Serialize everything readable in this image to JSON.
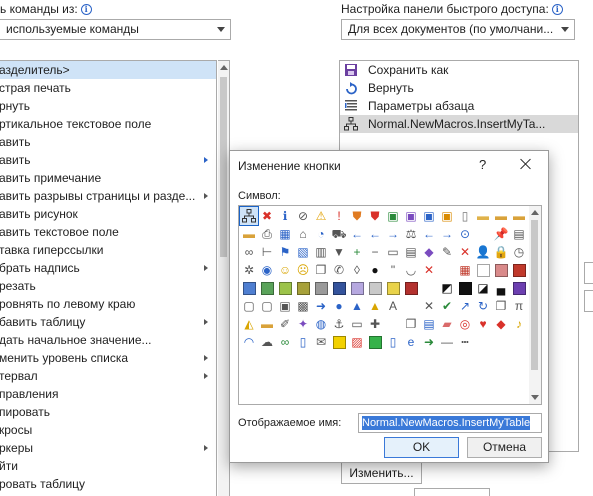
{
  "left_panel": {
    "label": "ь команды из:",
    "combo_value": "используемые команды",
    "items": [
      {
        "label": "азделитель>",
        "selected": true,
        "submenu": false
      },
      {
        "label": "страя печать",
        "submenu": false
      },
      {
        "label": "рнуть",
        "submenu": false
      },
      {
        "label": "ртикальное текстовое поле",
        "submenu": false
      },
      {
        "label": "авить",
        "submenu": false
      },
      {
        "label": "авить",
        "submenu": true
      },
      {
        "label": "авить примечание",
        "submenu": false
      },
      {
        "label": "авить разрывы страницы и разде...",
        "submenu": true
      },
      {
        "label": "авить рисунок",
        "submenu": false
      },
      {
        "label": "авить текстовое поле",
        "submenu": false
      },
      {
        "label": "тавка гиперссылки",
        "submenu": false
      },
      {
        "label": "брать надпись",
        "submenu": true
      },
      {
        "label": "резать",
        "submenu": false
      },
      {
        "label": "ровнять по левому краю",
        "submenu": false
      },
      {
        "label": "бавить таблицу",
        "submenu": true
      },
      {
        "label": "дать начальное значение...",
        "submenu": false
      },
      {
        "label": "менить уровень списка",
        "submenu": true
      },
      {
        "label": "тервал",
        "submenu": true
      },
      {
        "label": "правления",
        "submenu": false
      },
      {
        "label": "пировать",
        "submenu": false
      },
      {
        "label": "кросы",
        "submenu": false
      },
      {
        "label": "ркеры",
        "submenu": true
      },
      {
        "label": "йти",
        "submenu": false
      },
      {
        "label": "ровать таблицу",
        "submenu": false
      }
    ]
  },
  "right_panel": {
    "label": "Настройка панели быстрого доступа:",
    "combo_value": "Для всех документов (по умолчани...",
    "items": [
      {
        "label": "Сохранить как",
        "icon": "save-as-icon"
      },
      {
        "label": "Вернуть",
        "icon": "redo-icon"
      },
      {
        "label": "Параметры абзаца",
        "icon": "paragraph-settings-icon"
      },
      {
        "label": "Normal.NewMacros.InsertMyTa...",
        "icon": "macro-icon",
        "selected": true
      }
    ],
    "change_button": "Изменить..."
  },
  "dialog": {
    "title": "Изменение кнопки",
    "help": "?",
    "symbol_label": "Символ:",
    "display_name_label": "Отображаемое имя:",
    "display_name_value": "Normal.NewMacros.InsertMyTable",
    "ok_label": "OK",
    "cancel_label": "Отмена",
    "icons": [
      [
        "sitemap-icon",
        "error-icon",
        "info-icon",
        "stop-icon",
        "warning-icon",
        "exclamation-icon",
        "shield-warning-icon",
        "shield-icon",
        "image-check-icon",
        "image-icon",
        "image-back-icon",
        "image-forward-icon",
        "document-icon",
        "folder-icon",
        "folder-open-icon"
      ],
      [
        "folder-tree-icon",
        "folder-copy-icon",
        "printer-icon",
        "calendar-icon",
        "home-icon",
        "pie-chart-icon",
        "cart-icon",
        "arrow-left-icon",
        "arrow-left2-icon",
        "arrow-right-icon",
        "scales-icon",
        "arrow-left3-icon",
        "arrow-right2-icon",
        "back-circle-icon",
        "blank-icon"
      ],
      [
        "pin-icon",
        "paste-icon",
        "link-icon",
        "tree-icon",
        "flag-icon",
        "box-icon",
        "bar-chart-icon",
        "filter-icon",
        "plus-icon",
        "minus-icon",
        "ruler-icon",
        "clipboard-icon",
        "shapes-icon",
        "pencil-icon",
        "map-icon"
      ],
      [
        "user-icon",
        "lock-icon",
        "clock-icon",
        "settings-icon",
        "earth-icon",
        "smile-icon",
        "sad-icon",
        "copy-icon",
        "phone-icon",
        "tag-icon",
        "eight-ball-icon",
        "quote-icon",
        "eye-icon",
        "no-eye-icon",
        "blank-icon"
      ],
      [
        "grid-icon",
        "white-square",
        "rose-square",
        "red-square",
        "blue-square",
        "green-square",
        "lime-square",
        "olive-square",
        "gray-square",
        "navy-square",
        "lavender-square",
        "gray-square-2",
        "yellow-square",
        "red-square-2",
        "blank-icon"
      ],
      [
        "split-square",
        "black-square",
        "half-square",
        "bottom-square",
        "purple-square",
        "window-icon",
        "frame-icon",
        "panel-icon",
        "checker-icon",
        "arrow-circle-icon",
        "sphere-icon",
        "chart-up-icon",
        "pyramid-icon",
        "letter-a-icon",
        "blank-icon"
      ],
      [
        "cross-icon",
        "check-icon",
        "chart-line-icon",
        "refresh-icon",
        "copy-plus-icon",
        "pi-icon",
        "paint-bucket-icon",
        "folder-picture-icon",
        "brush-icon",
        "wand-icon",
        "globe-icon",
        "anchor-icon",
        "briefcase-icon",
        "puzzle-icon",
        "blank-icon"
      ],
      [
        "documents-icon",
        "database-icon",
        "eraser-icon",
        "dart-icon",
        "heart-icon",
        "bookmark-icon",
        "bell-icon",
        "rainbow-icon",
        "cloud-icon",
        "ribbon-icon",
        "door-icon",
        "mail-icon",
        "yellow-square-2",
        "stripes-icon",
        "green-square-2"
      ],
      [
        "document-blue-icon",
        "ie-icon",
        "arrow-green-icon",
        "line-icon",
        "dash-line-icon",
        "blank-icon",
        "blank-icon",
        "blank-icon",
        "blank-icon",
        "blank-icon",
        "blank-icon",
        "blank-icon",
        "blank-icon",
        "blank-icon",
        "blank-icon"
      ]
    ]
  }
}
